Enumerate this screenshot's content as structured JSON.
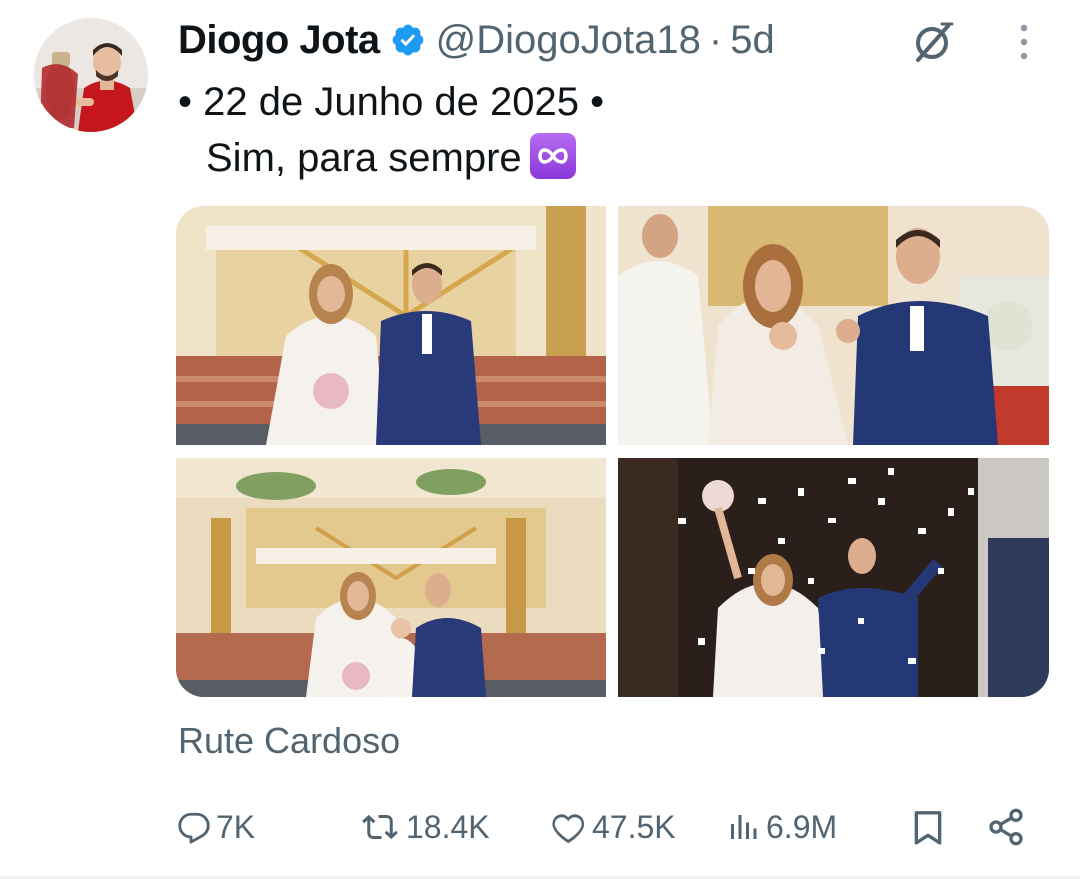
{
  "post": {
    "author_name": "Diogo Jota",
    "handle": "@DiogoJota18",
    "separator": "·",
    "time": "5d",
    "text_line1": "• 22 de Junho de 2025 •",
    "text_line2": "Sim, para sempre",
    "emoji": "infinity-emoji",
    "media_credit": "Rute Cardoso"
  },
  "icons": {
    "verified": "verified-badge-icon",
    "grok": "grok-icon",
    "more": "more-options-icon"
  },
  "media": [
    {
      "name": "photo-couple-at-altar"
    },
    {
      "name": "photo-couple-showing-rings"
    },
    {
      "name": "photo-couple-with-child-at-altar"
    },
    {
      "name": "photo-couple-leaving-church-confetti"
    }
  ],
  "actions": {
    "replies": "7K",
    "reposts": "18.4K",
    "likes": "47.5K",
    "views": "6.9M"
  },
  "colors": {
    "text_primary": "#0f1419",
    "text_secondary": "#536471",
    "verified_blue": "#1d9bf0",
    "emoji_purple": "#9b4ae6"
  }
}
